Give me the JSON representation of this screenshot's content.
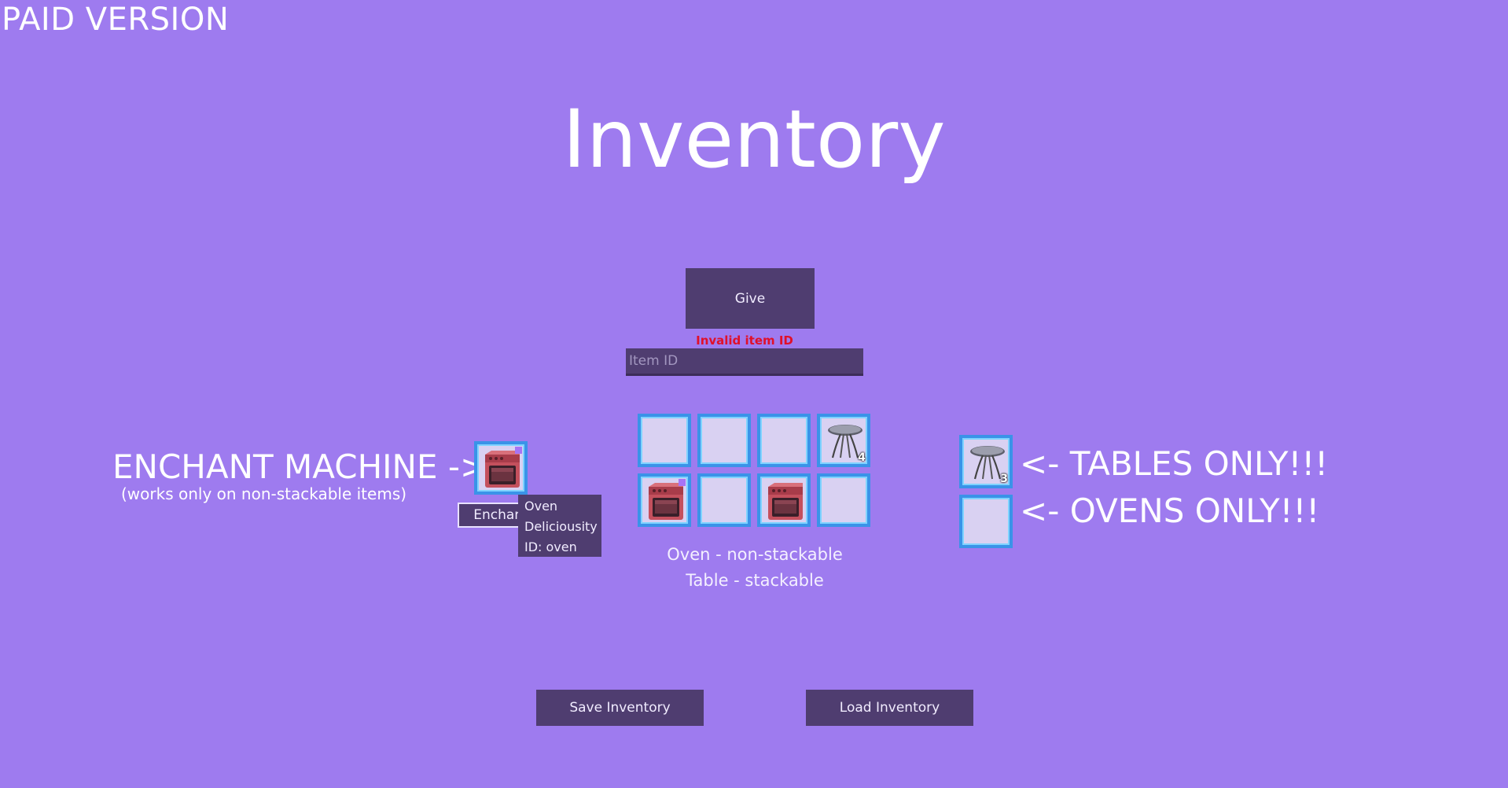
{
  "header": {
    "paid_label": "PAID VERSION",
    "title": "Inventory"
  },
  "give_panel": {
    "give_label": "Give",
    "error_text": "Invalid item ID",
    "item_id_placeholder": "Item ID",
    "item_id_value": ""
  },
  "enchant": {
    "heading": "ENCHANT MACHINE ->",
    "subtitle": "(works only on non-stackable items)",
    "button_label": "Enchant",
    "slot_icon": "oven-icon"
  },
  "tooltip": {
    "lines": [
      "Oven",
      "Deliciousity",
      "ID: oven"
    ]
  },
  "inventory": {
    "slots": [
      {
        "icon": "",
        "qty": ""
      },
      {
        "icon": "",
        "qty": ""
      },
      {
        "icon": "",
        "qty": ""
      },
      {
        "icon": "table-icon",
        "qty": "4"
      },
      {
        "icon": "oven-icon",
        "qty": "",
        "enchanted": true
      },
      {
        "icon": "",
        "qty": ""
      },
      {
        "icon": "oven-icon",
        "qty": ""
      },
      {
        "icon": "",
        "qty": ""
      }
    ],
    "info_lines": [
      "Oven - non-stackable",
      "Table - stackable"
    ]
  },
  "restricted": {
    "tables_label": "<- TABLES ONLY!!!",
    "tables_slot": {
      "icon": "table-icon",
      "qty": "3"
    },
    "ovens_label": "<- OVENS ONLY!!!",
    "ovens_slot": {
      "icon": "",
      "qty": ""
    }
  },
  "footer": {
    "save_label": "Save Inventory",
    "load_label": "Load Inventory"
  },
  "colors": {
    "background": "#9e7bef",
    "button": "#4f3d70",
    "slot_border": "#3a93e8",
    "error": "#e0102a"
  }
}
